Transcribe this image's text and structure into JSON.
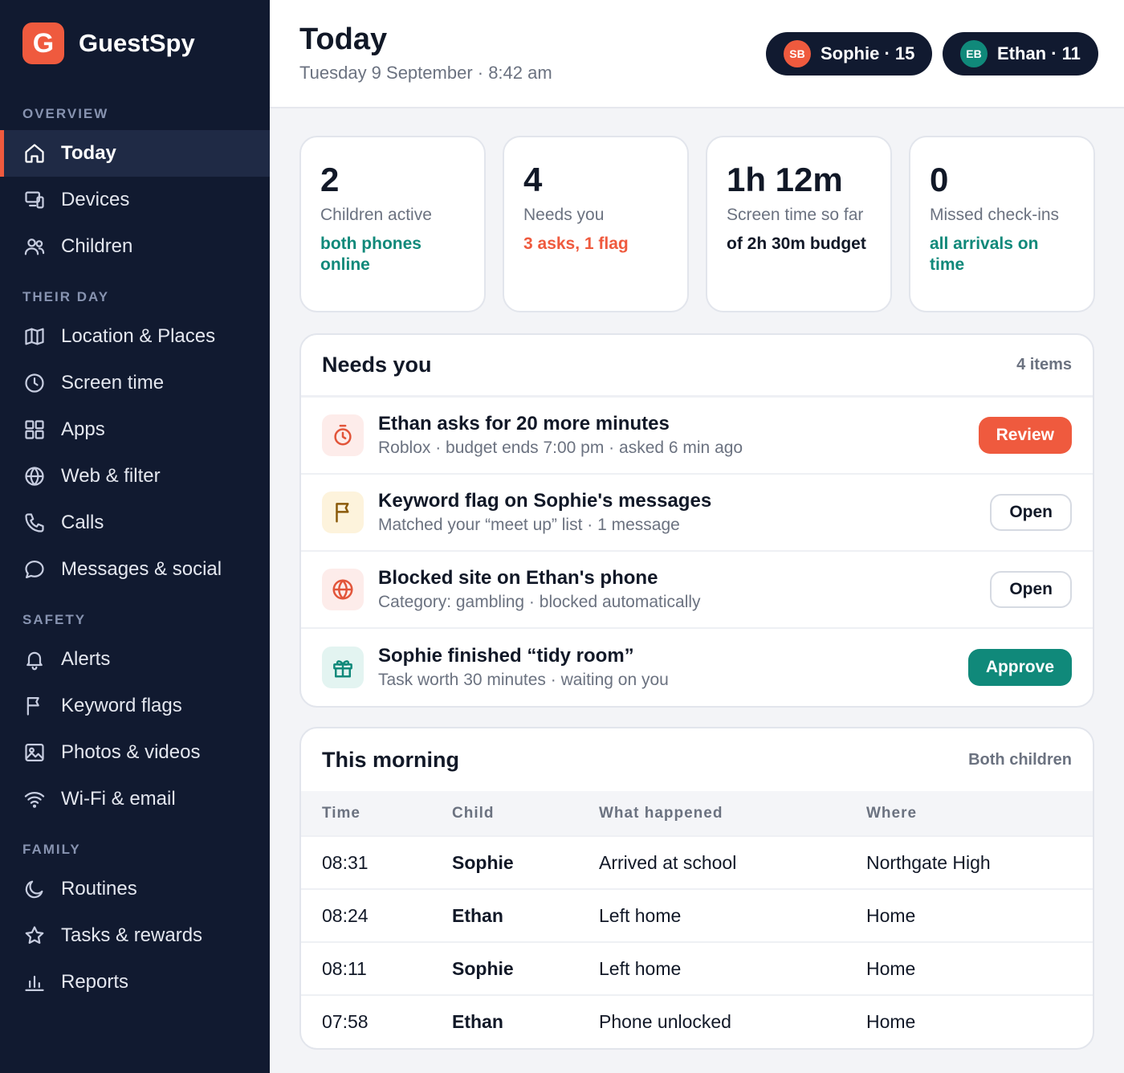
{
  "app": {
    "name": "GuestSpy",
    "logo_letter": "G",
    "accent": "#ef5a3e"
  },
  "sidebar": {
    "sections": [
      "OVERVIEW",
      "THEIR DAY",
      "SAFETY",
      "FAMILY"
    ],
    "items": [
      {
        "label": "Today",
        "icon": "home-icon",
        "active": true
      },
      {
        "label": "Devices",
        "icon": "devices-icon"
      },
      {
        "label": "Children",
        "icon": "users-icon"
      },
      {
        "label": "Location & Places",
        "icon": "map-icon"
      },
      {
        "label": "Screen time",
        "icon": "clock-icon"
      },
      {
        "label": "Apps",
        "icon": "grid-icon"
      },
      {
        "label": "Web & filter",
        "icon": "globe-icon"
      },
      {
        "label": "Calls",
        "icon": "phone-icon"
      },
      {
        "label": "Messages & social",
        "icon": "chat-icon"
      },
      {
        "label": "Alerts",
        "icon": "bell-icon"
      },
      {
        "label": "Keyword flags",
        "icon": "flag-icon"
      },
      {
        "label": "Photos & videos",
        "icon": "image-icon"
      },
      {
        "label": "Wi-Fi & email",
        "icon": "wifi-icon"
      },
      {
        "label": "Routines",
        "icon": "moon-icon"
      },
      {
        "label": "Tasks & rewards",
        "icon": "star-icon"
      },
      {
        "label": "Reports",
        "icon": "bar-chart-icon"
      }
    ]
  },
  "header": {
    "title": "Today",
    "date": "Tuesday 9 September · 8:42 am",
    "children": [
      {
        "initials": "SB",
        "label": "Sophie · 15",
        "color": "#ef5a3e"
      },
      {
        "initials": "EB",
        "label": "Ethan · 11",
        "color": "#10897a"
      }
    ]
  },
  "stats": [
    {
      "value": "2",
      "label": "Children active",
      "sub": "both phones online",
      "sub_color": "#10897a"
    },
    {
      "value": "4",
      "label": "Needs you",
      "sub": "3 asks, 1 flag",
      "sub_color": "#ef5a3e"
    },
    {
      "value": "1h 12m",
      "label": "Screen time so far",
      "sub": "of 2h 30m budget",
      "sub_color": "#111827"
    },
    {
      "value": "0",
      "label": "Missed check-ins",
      "sub": "all arrivals on time",
      "sub_color": "#10897a"
    }
  ],
  "needs": {
    "title": "Needs you",
    "count": "4 items",
    "items": [
      {
        "icon": "timer-icon",
        "title": "Ethan asks for 20 more minutes",
        "sub": "Roblox · budget ends 7:00 pm · asked 6 min ago",
        "action": "Review"
      },
      {
        "icon": "flag-icon",
        "title": "Keyword flag on Sophie's messages",
        "sub": "Matched your “meet up” list · 1 message",
        "action": "Open"
      },
      {
        "icon": "globe-icon",
        "title": "Blocked site on Ethan's phone",
        "sub": "Category: gambling · blocked automatically",
        "action": "Open"
      },
      {
        "icon": "gift-icon",
        "title": "Sophie finished “tidy room”",
        "sub": "Task worth 30 minutes · waiting on you",
        "action": "Approve"
      }
    ]
  },
  "morning": {
    "title": "This morning",
    "filter": "Both children",
    "columns": [
      "Time",
      "Child",
      "What happened",
      "Where"
    ],
    "rows": [
      [
        "08:31",
        "Sophie",
        "Arrived at school",
        "Northgate High"
      ],
      [
        "08:24",
        "Ethan",
        "Left home",
        "Home"
      ],
      [
        "08:11",
        "Sophie",
        "Left home",
        "Home"
      ],
      [
        "07:58",
        "Ethan",
        "Phone unlocked",
        "Home"
      ]
    ]
  }
}
